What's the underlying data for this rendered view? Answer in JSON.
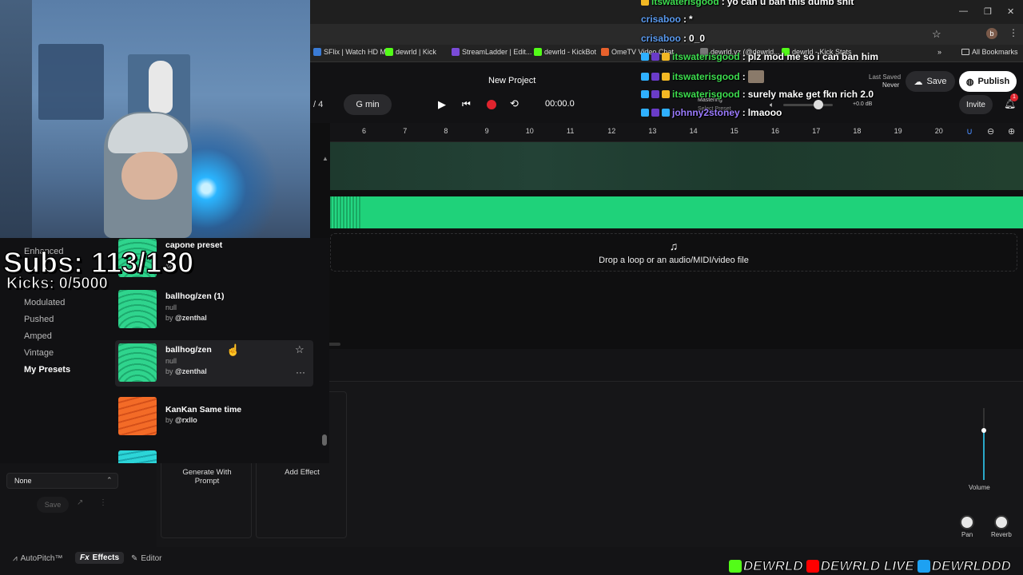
{
  "browser": {
    "bookmarks": [
      {
        "label": "SFlix | Watch HD M...",
        "color": "#3a7bd5"
      },
      {
        "label": "dewrld | Kick",
        "color": "#53fc18"
      },
      {
        "label": "StreamLadder | Edit...",
        "color": "#7a4bd8"
      },
      {
        "label": "dewrld - KickBot",
        "color": "#53fc18"
      },
      {
        "label": "OmeTV Video Chat",
        "color": "#e8612c"
      },
      {
        "label": "dewrld.yz (@dewrld...",
        "color": "#777777"
      },
      {
        "label": "dewrld - Kick Stats",
        "color": "#53fc18"
      }
    ],
    "all_bookmarks": "All Bookmarks",
    "profile_initial": "b"
  },
  "header": {
    "project_title": "New Project",
    "time_sig": "/ 4",
    "key": "G min",
    "time_display": "00:00.0",
    "last_saved_label": "Last Saved",
    "last_saved_value": "Never",
    "save_label": "Save",
    "publish_label": "Publish",
    "invite_label": "Invite",
    "notification_count": "1",
    "mastering_label": "Mastering",
    "select_preset_label": "Select Preset",
    "db_readout": "+0.0 dB"
  },
  "ruler": [
    "6",
    "7",
    "8",
    "9",
    "10",
    "11",
    "12",
    "13",
    "14",
    "15",
    "16",
    "17",
    "18",
    "19",
    "20"
  ],
  "drop_zone": "Drop a loop or an audio/MIDI/video file",
  "categories": [
    {
      "label": "Enhanced",
      "active": false
    },
    {
      "label": "Modulated",
      "active": false
    },
    {
      "label": "Pushed",
      "active": false
    },
    {
      "label": "Amped",
      "active": false
    },
    {
      "label": "Vintage",
      "active": false
    },
    {
      "label": "My Presets",
      "active": true
    }
  ],
  "presets": [
    {
      "title": "capone preset",
      "sub": "",
      "by": "@",
      "color": "green"
    },
    {
      "title": "ballhog/zen (1)",
      "sub": "null",
      "by": "@zenthal",
      "color": "green"
    },
    {
      "title": "ballhog/zen",
      "sub": "null",
      "by": "@zenthal",
      "color": "green"
    },
    {
      "title": "KanKan Same time",
      "sub": "",
      "by": "@rxllo",
      "color": "orange"
    },
    {
      "title": "",
      "sub": "",
      "by": "",
      "color": "cyan"
    }
  ],
  "preset_select": {
    "value": "None",
    "save_label": "Save"
  },
  "effects": {
    "generate_label": "Generate With Prompt",
    "add_label": "Add Effect"
  },
  "mixer": {
    "volume_label": "Volume",
    "pan_label": "Pan",
    "reverb_label": "Reverb"
  },
  "bottom_tabs": [
    {
      "label": "AutoPitch™",
      "icon": "pitch-icon",
      "active": false
    },
    {
      "label": "Effects",
      "icon": "fx-icon",
      "active": true
    },
    {
      "label": "Editor",
      "icon": "pencil-icon",
      "active": false
    }
  ],
  "chat": [
    {
      "user": "itswaterisgood",
      "color": "#3ddc4f",
      "msg": "yo can u ban this dumb shit"
    },
    {
      "user": "crisaboo",
      "color": "#5b9bf0",
      "msg": "*"
    },
    {
      "user": "crisaboo",
      "color": "#5b9bf0",
      "msg": "0_0"
    },
    {
      "user": "itswaterisgood",
      "color": "#3ddc4f",
      "msg": "plz mod me so i can ban him"
    },
    {
      "user": "itswaterisgood",
      "color": "#3ddc4f",
      "msg": ""
    },
    {
      "user": "itswaterisgood",
      "color": "#3ddc4f",
      "msg": "surely make get fkn rich 2.0"
    },
    {
      "user": "johnny2stoney",
      "color": "#9b7bff",
      "msg": "lmaooo"
    }
  ],
  "overlay": {
    "subs": "Subs: 113/130",
    "kicks": "Kicks: 0/5000"
  },
  "socials": [
    "DEWRLD",
    "DEWRLD LIVE",
    "DEWRLDDD"
  ]
}
